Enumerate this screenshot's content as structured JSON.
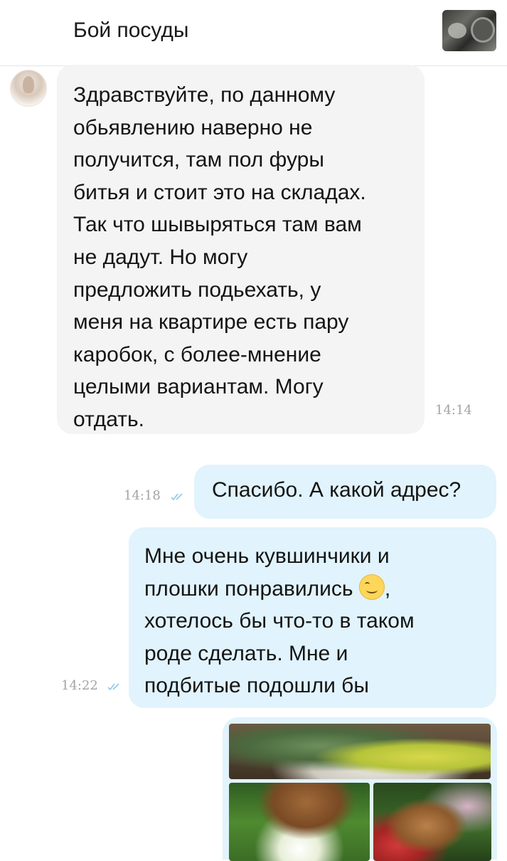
{
  "header": {
    "title": "Бой посуды",
    "listing_thumbnail_icon": "listing-photo"
  },
  "messages": [
    {
      "direction": "incoming",
      "lines": [
        "Здравствуйте, по данному",
        "обьявлению наверно не",
        "получится, там пол фуры",
        "битья и стоит это на складах.",
        "Так что шывыряться там вам",
        "не дадут. Но могу",
        "предложить подьехать, у",
        "меня на квартире есть пару",
        "каробок, с более-мнение",
        "целыми вариантам. Могу",
        "отдать."
      ],
      "time": "14:14"
    },
    {
      "direction": "outgoing",
      "lines": [
        "Спасибо. А какой адрес?"
      ],
      "time": "14:18",
      "status_icon": "double-check-icon"
    },
    {
      "direction": "outgoing",
      "lines": [
        "Мне очень кувшинчики и",
        "плошки понравились",
        "хотелось бы что-то в таком",
        "роде сделать. Мне и",
        "подбитые подошли бы"
      ],
      "line2_suffix": ",",
      "emoji": "smiling-face-emoji",
      "time": "14:22",
      "status_icon": "double-check-icon"
    }
  ],
  "photo_message": {
    "images": [
      "succulent-garden-photo",
      "tipped-pot-flowers-photo",
      "clay-pot-flowerbed-photo"
    ]
  },
  "colors": {
    "incoming_bubble": "#f4f4f4",
    "outgoing_bubble": "#e1f3fc",
    "read_check": "#8fc9e6",
    "timestamp": "#a3a3a3"
  }
}
